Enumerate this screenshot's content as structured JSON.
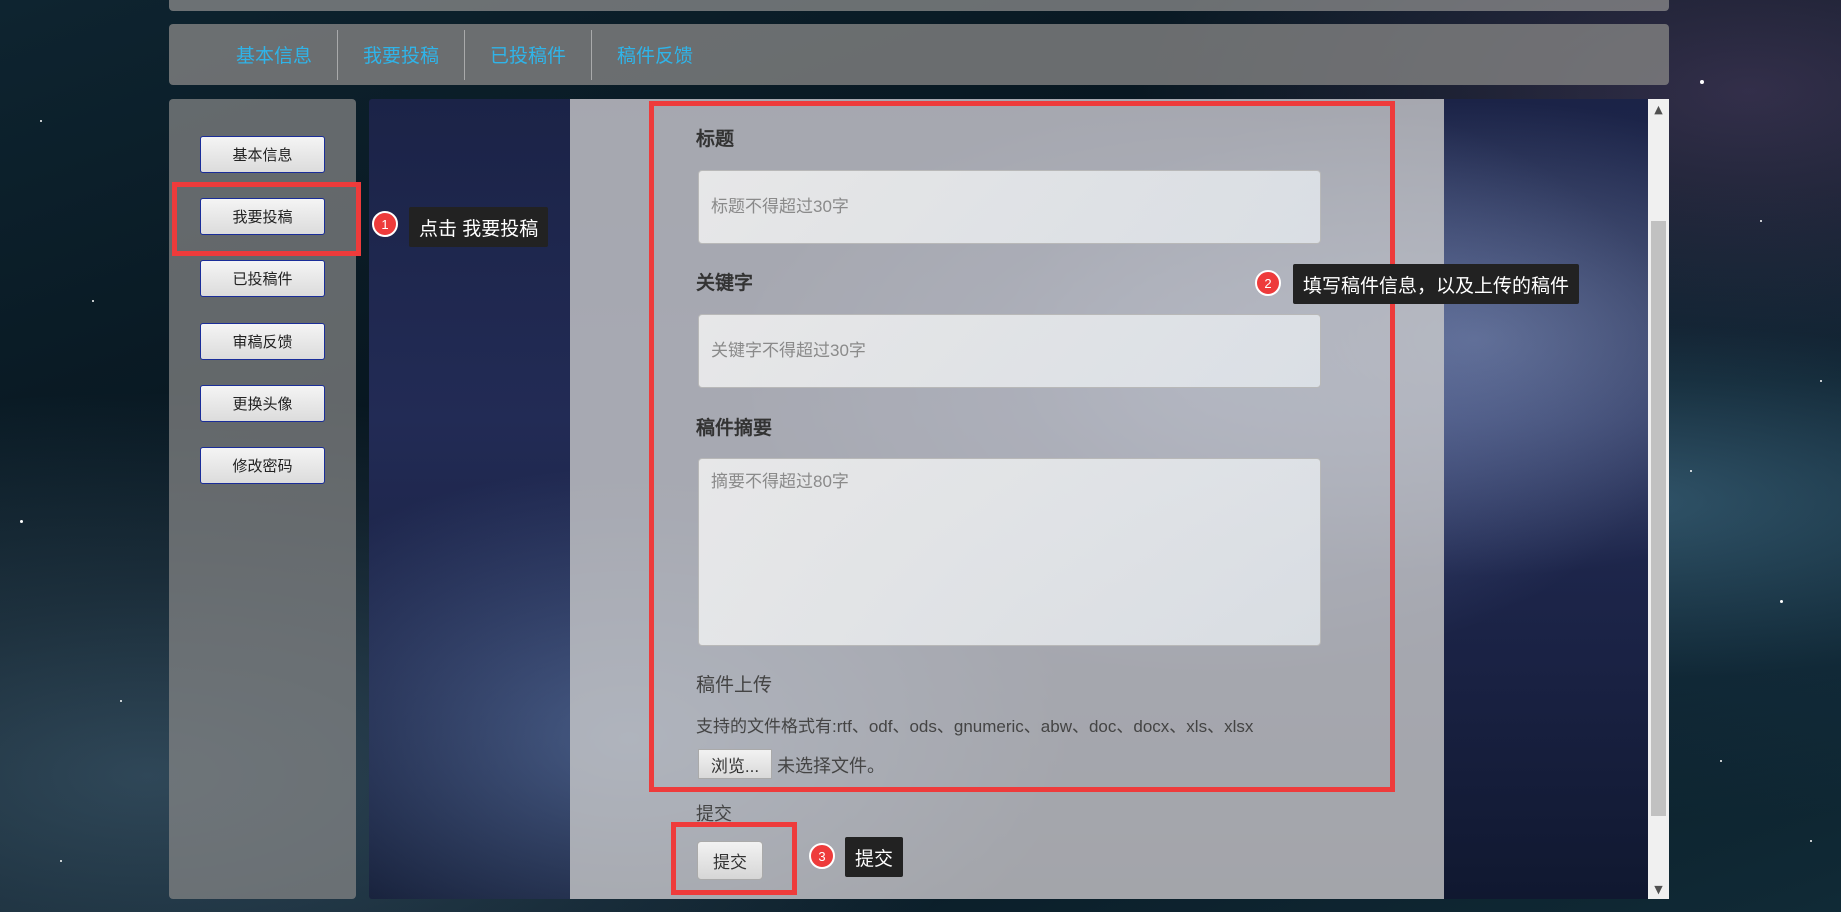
{
  "topnav": {
    "tabs": [
      {
        "label": "基本信息"
      },
      {
        "label": "我要投稿"
      },
      {
        "label": "已投稿件"
      },
      {
        "label": "稿件反馈"
      }
    ]
  },
  "sidebar": {
    "items": [
      {
        "label": "基本信息"
      },
      {
        "label": "我要投稿"
      },
      {
        "label": "已投稿件"
      },
      {
        "label": "审稿反馈"
      },
      {
        "label": "更换头像"
      },
      {
        "label": "修改密码"
      }
    ]
  },
  "form": {
    "title_label": "标题",
    "title_placeholder": "标题不得超过30字",
    "keyword_label": "关键字",
    "keyword_placeholder": "关键字不得超过30字",
    "abstract_label": "稿件摘要",
    "abstract_placeholder": "摘要不得超过80字",
    "upload_label": "稿件上传",
    "formats_text": "支持的文件格式有:rtf、odf、ods、gnumeric、abw、doc、docx、xls、xlsx",
    "browse_label": "浏览...",
    "no_file_text": "未选择文件。",
    "submit_heading": "提交",
    "submit_label": "提交"
  },
  "annotations": [
    {
      "number": "1",
      "text": "点击 我要投稿"
    },
    {
      "number": "2",
      "text": "填写稿件信息，以及上传的稿件"
    },
    {
      "number": "3",
      "text": "提交"
    }
  ],
  "colors": {
    "highlight": "#ee3b3b",
    "nav_link": "#2fb4e9",
    "button_border": "#1a2d99"
  }
}
